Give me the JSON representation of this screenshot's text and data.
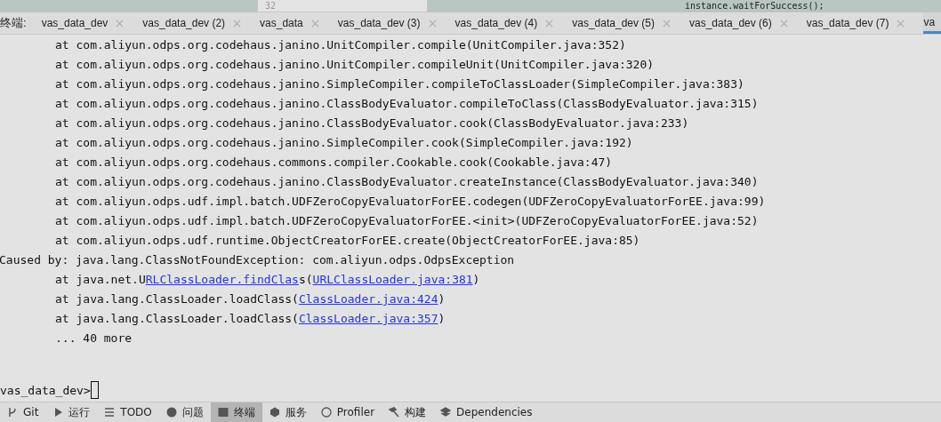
{
  "editor_strip": {
    "line_number": "32",
    "code": "instance.waitForSuccess();"
  },
  "terminal_tabs": {
    "label": "终端:",
    "tabs": [
      {
        "title": "vas_data_dev",
        "selected": false
      },
      {
        "title": "vas_data_dev (2)",
        "selected": false
      },
      {
        "title": "vas_data",
        "selected": false
      },
      {
        "title": "vas_data_dev (3)",
        "selected": false
      },
      {
        "title": "vas_data_dev (4)",
        "selected": false
      },
      {
        "title": "vas_data_dev (5)",
        "selected": false
      },
      {
        "title": "vas_data_dev (6)",
        "selected": false
      },
      {
        "title": "vas_data_dev (7)",
        "selected": false
      },
      {
        "title": "va",
        "selected": true
      }
    ]
  },
  "output": [
    {
      "kind": "frame",
      "segments": [
        {
          "text": "at com.aliyun.odps.org.codehaus.janino.UnitCompiler.compile(UnitCompiler.java:352)",
          "link": false
        }
      ]
    },
    {
      "kind": "frame",
      "segments": [
        {
          "text": "at com.aliyun.odps.org.codehaus.janino.UnitCompiler.compileUnit(UnitCompiler.java:320)",
          "link": false
        }
      ]
    },
    {
      "kind": "frame",
      "segments": [
        {
          "text": "at com.aliyun.odps.org.codehaus.janino.SimpleCompiler.compileToClassLoader(SimpleCompiler.java:383)",
          "link": false
        }
      ]
    },
    {
      "kind": "frame",
      "segments": [
        {
          "text": "at com.aliyun.odps.org.codehaus.janino.ClassBodyEvaluator.compileToClass(ClassBodyEvaluator.java:315)",
          "link": false
        }
      ]
    },
    {
      "kind": "frame",
      "segments": [
        {
          "text": "at com.aliyun.odps.org.codehaus.janino.ClassBodyEvaluator.cook(ClassBodyEvaluator.java:233)",
          "link": false
        }
      ]
    },
    {
      "kind": "frame",
      "segments": [
        {
          "text": "at com.aliyun.odps.org.codehaus.janino.SimpleCompiler.cook(SimpleCompiler.java:192)",
          "link": false
        }
      ]
    },
    {
      "kind": "frame",
      "segments": [
        {
          "text": "at com.aliyun.odps.org.codehaus.commons.compiler.Cookable.cook(Cookable.java:47)",
          "link": false
        }
      ]
    },
    {
      "kind": "frame",
      "segments": [
        {
          "text": "at com.aliyun.odps.org.codehaus.janino.ClassBodyEvaluator.createInstance(ClassBodyEvaluator.java:340)",
          "link": false
        }
      ]
    },
    {
      "kind": "frame",
      "segments": [
        {
          "text": "at com.aliyun.odps.udf.impl.batch.UDFZeroCopyEvaluatorForEE.codegen(UDFZeroCopyEvaluatorForEE.java:99)",
          "link": false
        }
      ]
    },
    {
      "kind": "frame",
      "segments": [
        {
          "text": "at com.aliyun.odps.udf.impl.batch.UDFZeroCopyEvaluatorForEE.<init>(UDFZeroCopyEvaluatorForEE.java:52)",
          "link": false
        }
      ]
    },
    {
      "kind": "frame",
      "segments": [
        {
          "text": "at com.aliyun.odps.udf.runtime.ObjectCreatorForEE.create(ObjectCreatorForEE.java:85)",
          "link": false
        }
      ]
    },
    {
      "kind": "cause",
      "segments": [
        {
          "text": "Caused by: java.lang.ClassNotFoundException: com.aliyun.odps.OdpsException",
          "link": false
        }
      ]
    },
    {
      "kind": "frame",
      "segments": [
        {
          "text": "at java.net.U",
          "link": false
        },
        {
          "text": "RLClassLoader.findClas",
          "link": true
        },
        {
          "text": "s(",
          "link": false
        },
        {
          "text": "URLClassLoader.java:381",
          "link": true
        },
        {
          "text": ")",
          "link": false
        }
      ]
    },
    {
      "kind": "frame",
      "segments": [
        {
          "text": "at java.lang.ClassLoader.loadClass(",
          "link": false
        },
        {
          "text": "ClassLoader.java:424",
          "link": true
        },
        {
          "text": ")",
          "link": false
        }
      ]
    },
    {
      "kind": "frame",
      "segments": [
        {
          "text": "at java.lang.ClassLoader.loadClass(",
          "link": false
        },
        {
          "text": "ClassLoader.java:357",
          "link": true
        },
        {
          "text": ")",
          "link": false
        }
      ]
    },
    {
      "kind": "frame",
      "segments": [
        {
          "text": "... 40 more",
          "link": false
        }
      ]
    }
  ],
  "prompt": "vas_data_dev>",
  "tool_windows": [
    {
      "label": "Git",
      "selected": false
    },
    {
      "label": "运行",
      "selected": false
    },
    {
      "label": "TODO",
      "selected": false
    },
    {
      "label": "问题",
      "selected": false
    },
    {
      "label": "终端",
      "selected": true
    },
    {
      "label": "服务",
      "selected": false
    },
    {
      "label": "Profiler",
      "selected": false
    },
    {
      "label": "构建",
      "selected": false
    },
    {
      "label": "Dependencies",
      "selected": false
    }
  ]
}
